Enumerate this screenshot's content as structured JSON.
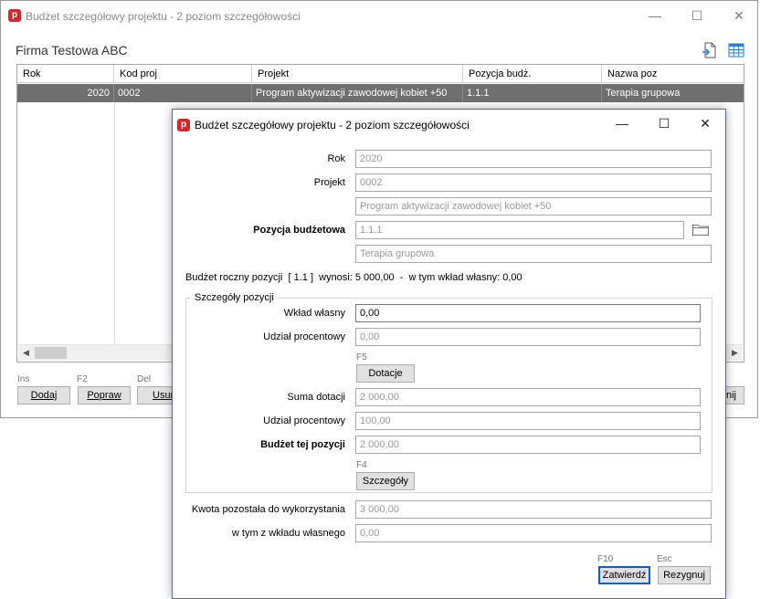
{
  "back_window": {
    "title": "Budżet szczegółowy projektu - 2 poziom szczegółowości",
    "app_icon_letter": "p",
    "controls": {
      "minimize": "—",
      "maximize": "☐",
      "close": "✕"
    },
    "firm_name": "Firma Testowa ABC",
    "table": {
      "headers": [
        "Rok",
        "Kod proj",
        "Projekt",
        "Pozycja budż.",
        "Nazwa poz"
      ],
      "rows": [
        {
          "rok": "2020",
          "kod": "0002",
          "projekt": "Program aktywizacji zawodowej kobiet +50",
          "pozycja": "1.1.1",
          "nazwa": "Terapia grupowa"
        }
      ]
    },
    "scroll_left": "◀",
    "scroll_right": "▶",
    "buttons": [
      {
        "hint": "Ins",
        "label": "Dodaj"
      },
      {
        "hint": "F2",
        "label": "Popraw"
      },
      {
        "hint": "Del",
        "label": "Usuń"
      }
    ],
    "partial_right_button": "nij"
  },
  "dialog": {
    "title": "Budżet szczegółowy projektu - 2 poziom szczegółowości",
    "app_icon_letter": "p",
    "controls": {
      "minimize": "—",
      "maximize": "☐",
      "close": "✕"
    },
    "rok_label": "Rok",
    "rok_value": "2020",
    "projekt_label": "Projekt",
    "projekt_code": "0002",
    "projekt_name": "Program aktywizacji zawodowej kobiet +50",
    "pozycja_label": "Pozycja budżetowa",
    "pozycja_value": "1.1.1",
    "pozycja_name": "Terapia grupowa",
    "info_line": "Budżet roczny pozycji  [ 1.1 ]  wynosi: 5 000,00  -  w tym wkład własny: 0,00",
    "group_title": "Szczegóły pozycji",
    "wklad_label": "Wkład własny",
    "wklad_value": "0,00",
    "udzial1_label": "Udział procentowy",
    "udzial1_value": "0,00",
    "dotacje_hint": "F5",
    "dotacje_button": "Dotacje",
    "suma_label": "Suma dotacji",
    "suma_value": "2 000,00",
    "udzial2_label": "Udział procentowy",
    "udzial2_value": "100,00",
    "budzet_label": "Budżet tej pozycji",
    "budzet_value": "2 000,00",
    "szczegoly_hint": "F4",
    "szczegoly_button": "Szczegóły",
    "kwota_label": "Kwota pozostała do wykorzystania",
    "kwota_value": "3 000,00",
    "wklad_wl_label": "w tym z wkładu własnego",
    "wklad_wl_value": "0,00",
    "ok_hint": "F10",
    "ok_button": "Zatwierdź",
    "cancel_hint": "Esc",
    "cancel_button": "Rezygnuj"
  },
  "colors": {
    "selected_row": "#6f6f6f",
    "app_icon": "#d8262f",
    "toolbar_icon": "#2d7fd0"
  }
}
